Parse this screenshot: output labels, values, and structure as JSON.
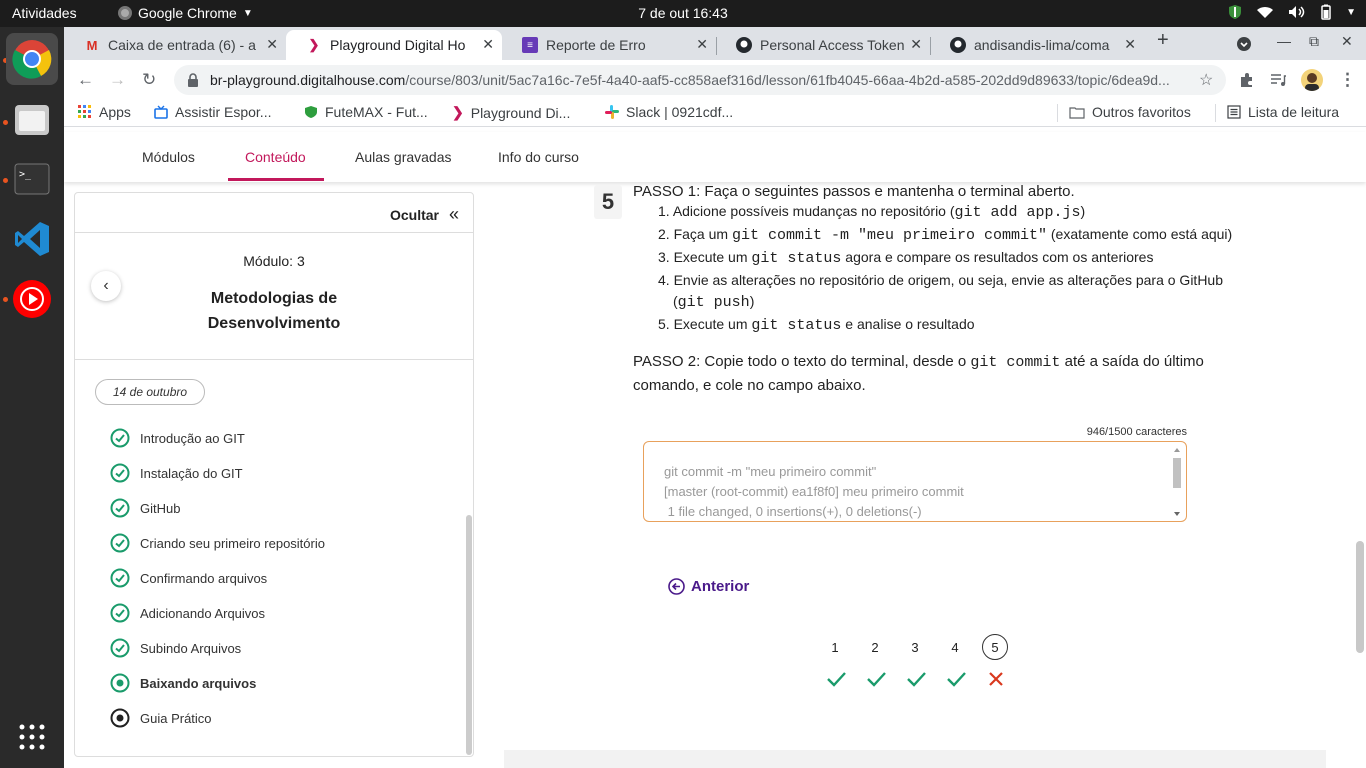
{
  "system": {
    "activities": "Atividades",
    "app_name": "Google Chrome",
    "clock": "7 de out  16:43"
  },
  "tabs": [
    {
      "title": "Caixa de entrada (6) - a",
      "icon": "gmail-icon"
    },
    {
      "title": "Playground Digital Ho",
      "icon": "digitalhouse-icon"
    },
    {
      "title": "Reporte de Erro",
      "icon": "forms-icon"
    },
    {
      "title": "Personal Access Token",
      "icon": "github-icon"
    },
    {
      "title": "andisandis-lima/coma",
      "icon": "github-icon"
    }
  ],
  "address": {
    "host": "br-playground.digitalhouse.com",
    "path": "/course/803/unit/5ac7a16c-7e5f-4a40-aaf5-cc858aef316d/lesson/61fb4045-66aa-4b2d-a585-202dd9d89633/topic/6dea9d..."
  },
  "bookmarks": {
    "items": [
      "Apps",
      "Assistir Espor...",
      "FuteMAX - Fut...",
      "Playground Di...",
      "Slack | 0921cdf..."
    ],
    "others": "Outros favoritos",
    "reading_list": "Lista de leitura"
  },
  "course_nav": {
    "items": [
      "Módulos",
      "Conteúdo",
      "Aulas gravadas",
      "Info do curso"
    ],
    "active": "Conteúdo"
  },
  "sidebar": {
    "hide_label": "Ocultar",
    "module_label": "Módulo:  3",
    "module_title": "Metodologias de Desenvolvimento",
    "date_pill": "14 de outubro",
    "lessons": [
      {
        "title": "Introdução ao GIT",
        "status": "done"
      },
      {
        "title": "Instalação do GIT",
        "status": "done"
      },
      {
        "title": "GitHub",
        "status": "done"
      },
      {
        "title": "Criando seu primeiro repositório",
        "status": "done"
      },
      {
        "title": "Confirmando arquivos",
        "status": "done"
      },
      {
        "title": "Adicionando Arquivos",
        "status": "done"
      },
      {
        "title": "Subindo Arquivos",
        "status": "done"
      },
      {
        "title": "Baixando arquivos",
        "status": "current"
      },
      {
        "title": "Guia Prático",
        "status": "pending"
      }
    ]
  },
  "exercise": {
    "step_number": "5",
    "passo1": "PASSO 1: Faça o seguintes passos e mantenha o terminal aberto.",
    "steps": [
      {
        "n": "1.",
        "a": "Adicione possíveis mudanças no repositório (",
        "code": "git add app.js",
        "b": ")"
      },
      {
        "n": "2.",
        "a": "Faça um ",
        "code": "git commit -m \"meu primeiro commit\"",
        "b": " (exatamente como está aqui)"
      },
      {
        "n": "3.",
        "a": "Execute um ",
        "code": "git status",
        "b": " agora e compare os resultados com os anteriores"
      },
      {
        "n": "4.",
        "a": "Envie as alterações no repositório de origem, ou seja, envie as alterações para o GitHub",
        "line2_open": "(",
        "code": "git push",
        "b": ")"
      },
      {
        "n": "5.",
        "a": "Execute um ",
        "code": "git status",
        "b": " e analise o resultado"
      }
    ],
    "passo2_a": "PASSO 2: Copie todo o texto do terminal, desde o ",
    "passo2_code": "git commit",
    "passo2_b": " até a saída do último comando, e cole no campo abaixo.",
    "char_counter": "946/1500 caracteres",
    "answer_lines": [
      "git commit -m \"meu primeiro commit\"",
      "[master (root-commit) ea1f8f0] meu primeiro commit",
      " 1 file changed, 0 insertions(+), 0 deletions(-)"
    ],
    "prev_label": "Anterior",
    "pagination": [
      "1",
      "2",
      "3",
      "4",
      "5"
    ],
    "current_page": "5",
    "results": [
      "correct",
      "correct",
      "correct",
      "correct",
      "wrong"
    ],
    "colors": {
      "correct": "#1a9b6b",
      "wrong": "#d9381e",
      "accent": "#c2185b"
    }
  }
}
